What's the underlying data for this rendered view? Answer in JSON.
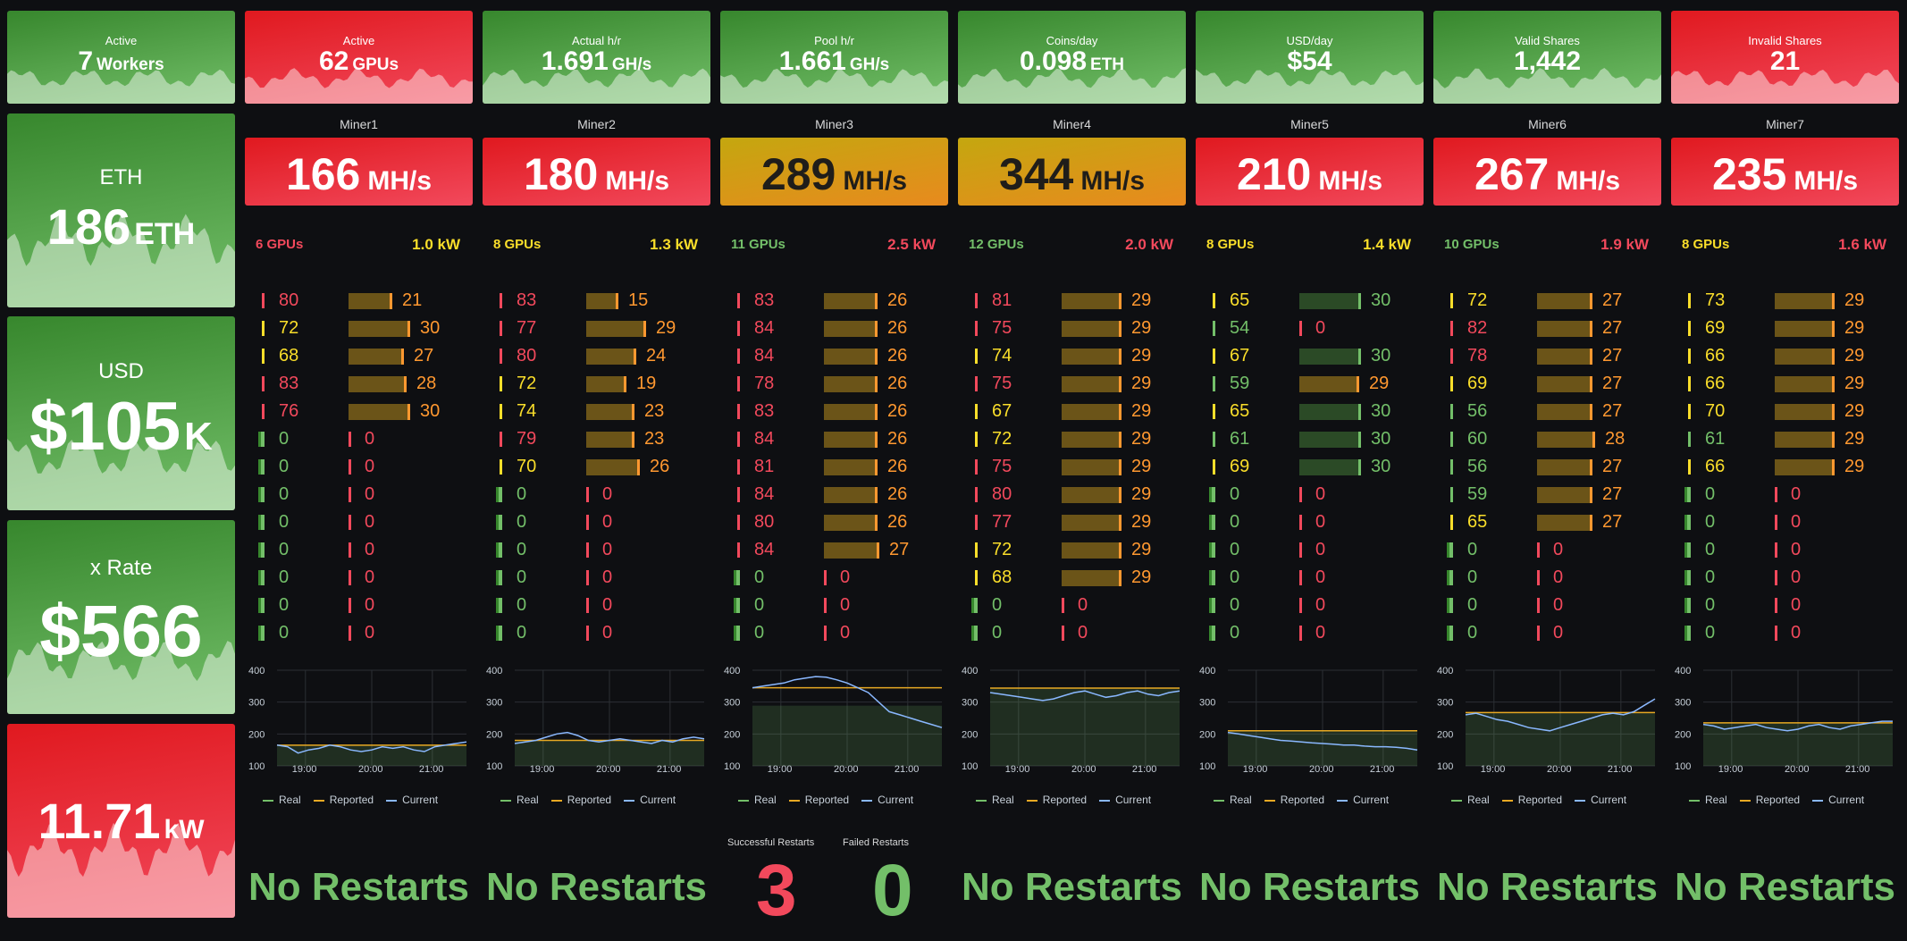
{
  "colors": {
    "green": "#73bf69",
    "red": "#f2495c",
    "yellow": "#fade2a",
    "orange": "#ff9830",
    "amber": "#e8a923",
    "bg": "#0e0f12"
  },
  "top_stats": [
    {
      "title": "Active",
      "value": "7",
      "unit": "Workers",
      "style": "green"
    },
    {
      "title": "Active",
      "value": "62",
      "unit": "GPUs",
      "style": "red"
    },
    {
      "title": "Actual h/r",
      "value": "1.691",
      "unit": "GH/s",
      "style": "green"
    },
    {
      "title": "Pool h/r",
      "value": "1.661",
      "unit": "GH/s",
      "style": "green"
    },
    {
      "title": "Coins/day",
      "value": "0.098",
      "unit": "ETH",
      "style": "green"
    },
    {
      "title": "USD/day",
      "value": "$54",
      "unit": "",
      "style": "green"
    },
    {
      "title": "Valid Shares",
      "value": "1,442",
      "unit": "",
      "style": "green"
    },
    {
      "title": "Invalid Shares",
      "value": "21",
      "unit": "",
      "style": "red"
    }
  ],
  "left_stats": [
    {
      "title": "ETH",
      "value": "186",
      "unit": "ETH",
      "style": "green"
    },
    {
      "title": "USD",
      "value": "$105",
      "unit": "K",
      "style": "green"
    },
    {
      "title": "x Rate",
      "value": "$566",
      "unit": "",
      "style": "green"
    },
    {
      "title": "",
      "value": "11.71",
      "unit": "kW",
      "style": "red"
    }
  ],
  "miners": [
    {
      "name": "Miner1",
      "hashrate": "166",
      "unit": "MH/s",
      "style": "red",
      "gpus": "6 GPUs",
      "gpus_color": "red",
      "power": "1.0 kW",
      "power_color": "yellow",
      "temps": [
        "80",
        "72",
        "68",
        "83",
        "76",
        "0",
        "0",
        "0",
        "0",
        "0",
        "0",
        "0",
        "0"
      ],
      "fans": [
        "21",
        "30",
        "27",
        "28",
        "30",
        "0",
        "0",
        "0",
        "0",
        "0",
        "0",
        "0",
        "0"
      ],
      "restarts": "No Restarts",
      "chart": {
        "real": 165,
        "reported": 165,
        "current": [
          165,
          160,
          140,
          150,
          155,
          165,
          160,
          150,
          145,
          150,
          160,
          155,
          160,
          150,
          145,
          160,
          165,
          170,
          175
        ]
      }
    },
    {
      "name": "Miner2",
      "hashrate": "180",
      "unit": "MH/s",
      "style": "red",
      "gpus": "8 GPUs",
      "gpus_color": "yellow",
      "power": "1.3 kW",
      "power_color": "yellow",
      "temps": [
        "83",
        "77",
        "80",
        "72",
        "74",
        "79",
        "70",
        "0",
        "0",
        "0",
        "0",
        "0",
        "0"
      ],
      "fans": [
        "15",
        "29",
        "24",
        "19",
        "23",
        "23",
        "26",
        "0",
        "0",
        "0",
        "0",
        "0",
        "0"
      ],
      "restarts": "No Restarts",
      "chart": {
        "real": 180,
        "reported": 180,
        "current": [
          170,
          175,
          180,
          190,
          200,
          205,
          195,
          180,
          175,
          180,
          185,
          180,
          175,
          170,
          180,
          175,
          185,
          190,
          185
        ]
      }
    },
    {
      "name": "Miner3",
      "hashrate": "289",
      "unit": "MH/s",
      "style": "amber",
      "gpus": "11 GPUs",
      "gpus_color": "green",
      "power": "2.5 kW",
      "power_color": "red",
      "temps": [
        "83",
        "84",
        "84",
        "78",
        "83",
        "84",
        "81",
        "84",
        "80",
        "84",
        "0",
        "0",
        "0"
      ],
      "fans": [
        "26",
        "26",
        "26",
        "26",
        "26",
        "26",
        "26",
        "26",
        "26",
        "27",
        "0",
        "0",
        "0"
      ],
      "restarts_success_title": "Successful Restarts",
      "restarts_success": "3",
      "restarts_failed_title": "Failed Restarts",
      "restarts_failed": "0",
      "chart": {
        "real": 289,
        "reported": 345,
        "current": [
          345,
          350,
          355,
          360,
          370,
          375,
          380,
          378,
          370,
          360,
          345,
          330,
          300,
          270,
          260,
          250,
          240,
          230,
          220
        ]
      }
    },
    {
      "name": "Miner4",
      "hashrate": "344",
      "unit": "MH/s",
      "style": "amber",
      "gpus": "12 GPUs",
      "gpus_color": "green",
      "power": "2.0 kW",
      "power_color": "red",
      "temps": [
        "81",
        "75",
        "74",
        "75",
        "67",
        "72",
        "75",
        "80",
        "77",
        "72",
        "68",
        "0",
        "0"
      ],
      "fans": [
        "29",
        "29",
        "29",
        "29",
        "29",
        "29",
        "29",
        "29",
        "29",
        "29",
        "29",
        "0",
        "0"
      ],
      "restarts": "No Restarts",
      "chart": {
        "real": 344,
        "reported": 344,
        "current": [
          330,
          325,
          320,
          315,
          310,
          305,
          310,
          320,
          330,
          335,
          325,
          315,
          320,
          330,
          335,
          325,
          320,
          330,
          335
        ]
      }
    },
    {
      "name": "Miner5",
      "hashrate": "210",
      "unit": "MH/s",
      "style": "red",
      "gpus": "8 GPUs",
      "gpus_color": "yellow",
      "power": "1.4 kW",
      "power_color": "yellow",
      "temps": [
        "65",
        "54",
        "67",
        "59",
        "65",
        "61",
        "69",
        "0",
        "0",
        "0",
        "0",
        "0",
        "0"
      ],
      "fans": [
        "30",
        "0",
        "30",
        "29",
        "30",
        "30",
        "30",
        "0",
        "0",
        "0",
        "0",
        "0",
        "0"
      ],
      "restarts": "No Restarts",
      "chart": {
        "real": 210,
        "reported": 210,
        "current": [
          205,
          200,
          195,
          190,
          185,
          180,
          178,
          175,
          172,
          170,
          168,
          165,
          165,
          162,
          160,
          160,
          158,
          155,
          150
        ]
      }
    },
    {
      "name": "Miner6",
      "hashrate": "267",
      "unit": "MH/s",
      "style": "red",
      "gpus": "10 GPUs",
      "gpus_color": "green",
      "power": "1.9 kW",
      "power_color": "red",
      "temps": [
        "72",
        "82",
        "78",
        "69",
        "56",
        "60",
        "56",
        "59",
        "65",
        "0",
        "0",
        "0",
        "0"
      ],
      "fans": [
        "27",
        "27",
        "27",
        "27",
        "27",
        "28",
        "27",
        "27",
        "27",
        "0",
        "0",
        "0",
        "0"
      ],
      "restarts": "No Restarts",
      "chart": {
        "real": 267,
        "reported": 267,
        "current": [
          260,
          265,
          255,
          245,
          240,
          230,
          220,
          215,
          210,
          220,
          230,
          240,
          250,
          260,
          265,
          260,
          270,
          290,
          310
        ]
      }
    },
    {
      "name": "Miner7",
      "hashrate": "235",
      "unit": "MH/s",
      "style": "red",
      "gpus": "8 GPUs",
      "gpus_color": "yellow",
      "power": "1.6 kW",
      "power_color": "red",
      "temps": [
        "73",
        "69",
        "66",
        "66",
        "70",
        "61",
        "66",
        "0",
        "0",
        "0",
        "0",
        "0",
        "0"
      ],
      "fans": [
        "29",
        "29",
        "29",
        "29",
        "29",
        "29",
        "29",
        "0",
        "0",
        "0",
        "0",
        "0",
        "0"
      ],
      "restarts": "No Restarts",
      "chart": {
        "real": 235,
        "reported": 235,
        "current": [
          230,
          225,
          215,
          220,
          225,
          230,
          220,
          215,
          210,
          215,
          225,
          230,
          220,
          215,
          225,
          230,
          235,
          240,
          240
        ]
      }
    }
  ],
  "chart_axis": {
    "yticks": [
      "400",
      "300",
      "200",
      "100"
    ],
    "xticks": [
      "19:00",
      "20:00",
      "21:00"
    ],
    "ylim": [
      100,
      400
    ]
  },
  "legend": {
    "real": "Real",
    "reported": "Reported",
    "current": "Current"
  }
}
